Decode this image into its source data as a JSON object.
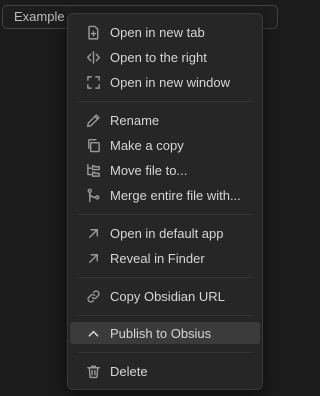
{
  "input": {
    "value": "Example"
  },
  "menu": {
    "items": [
      {
        "label": "Open in new tab",
        "icon": "open-new-tab-icon"
      },
      {
        "label": "Open to the right",
        "icon": "split-right-icon"
      },
      {
        "label": "Open in new window",
        "icon": "new-window-icon"
      },
      {
        "label": "Rename",
        "icon": "pencil-icon"
      },
      {
        "label": "Make a copy",
        "icon": "copy-icon"
      },
      {
        "label": "Move file to...",
        "icon": "folder-tree-icon"
      },
      {
        "label": "Merge entire file with...",
        "icon": "git-merge-icon"
      },
      {
        "label": "Open in default app",
        "icon": "arrow-up-right-icon"
      },
      {
        "label": "Reveal in Finder",
        "icon": "arrow-up-right-icon"
      },
      {
        "label": "Copy Obsidian URL",
        "icon": "link-icon"
      },
      {
        "label": "Publish to Obsius",
        "icon": "chevron-up-icon"
      },
      {
        "label": "Delete",
        "icon": "trash-icon"
      }
    ],
    "highlighted": "Publish to Obsius"
  },
  "colors": {
    "background": "#1b1b1b",
    "menu_background": "#262626",
    "highlight": "#3b3b3b",
    "text": "#d6d6d6"
  }
}
